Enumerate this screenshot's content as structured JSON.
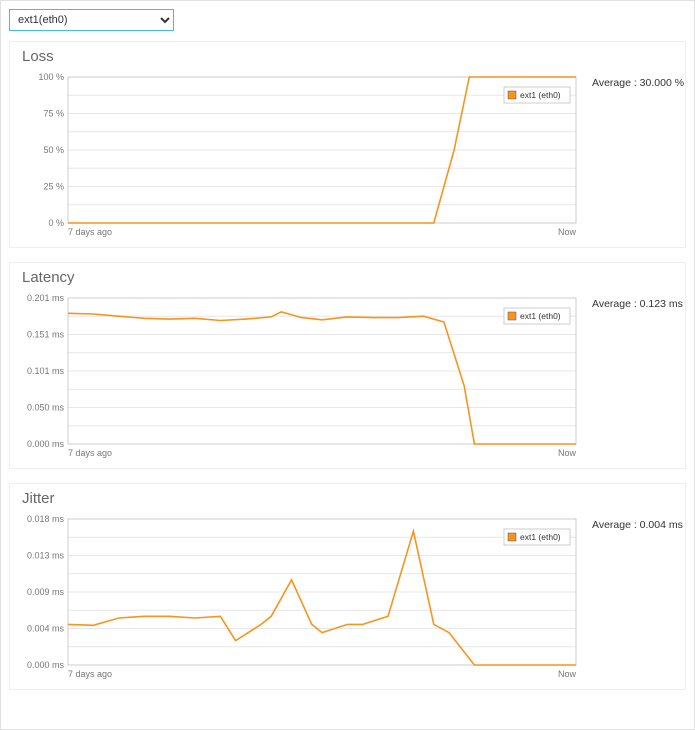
{
  "dropdown": {
    "selected": "ext1(eth0)"
  },
  "legend_label": "ext1 (eth0)",
  "time_axis": {
    "left": "7 days ago",
    "right": "Now"
  },
  "avg_label_prefix": "Average :  ",
  "charts": [
    {
      "key": "loss",
      "title": "Loss",
      "avg": "30.000 %",
      "y_ticks": [
        "0 %",
        "25 %",
        "50 %",
        "75 %",
        "100 %"
      ],
      "ymax": 100
    },
    {
      "key": "latency",
      "title": "Latency",
      "avg": "0.123 ms",
      "y_ticks": [
        "0.000 ms",
        "0.050 ms",
        "0.101 ms",
        "0.151 ms",
        "0.201 ms"
      ],
      "ymax": 0.201
    },
    {
      "key": "jitter",
      "title": "Jitter",
      "avg": "0.004 ms",
      "y_ticks": [
        "0.000 ms",
        "0.004 ms",
        "0.009 ms",
        "0.013 ms",
        "0.018 ms"
      ],
      "ymax": 0.018
    }
  ],
  "chart_data": [
    {
      "type": "line",
      "title": "Loss",
      "xlabel": "",
      "ylabel": "",
      "ylim": [
        0,
        100
      ],
      "x_range": "7 days ago to Now",
      "series": [
        {
          "name": "ext1 (eth0)",
          "x": [
            0.0,
            0.6,
            0.72,
            0.76,
            0.79,
            0.81,
            1.0
          ],
          "values": [
            0,
            0,
            0,
            50,
            100,
            100,
            100
          ]
        }
      ],
      "average": 30.0,
      "unit": "%"
    },
    {
      "type": "line",
      "title": "Latency",
      "xlabel": "",
      "ylabel": "",
      "ylim": [
        0,
        0.201
      ],
      "x_range": "7 days ago to Now",
      "series": [
        {
          "name": "ext1 (eth0)",
          "x": [
            0.0,
            0.05,
            0.1,
            0.15,
            0.2,
            0.25,
            0.3,
            0.35,
            0.4,
            0.42,
            0.46,
            0.5,
            0.55,
            0.6,
            0.65,
            0.7,
            0.74,
            0.78,
            0.8,
            1.0
          ],
          "values": [
            0.18,
            0.179,
            0.176,
            0.173,
            0.172,
            0.173,
            0.17,
            0.172,
            0.175,
            0.182,
            0.174,
            0.171,
            0.175,
            0.174,
            0.174,
            0.176,
            0.168,
            0.08,
            0.0,
            0.0
          ]
        }
      ],
      "average": 0.123,
      "unit": "ms"
    },
    {
      "type": "line",
      "title": "Jitter",
      "xlabel": "",
      "ylabel": "",
      "ylim": [
        0,
        0.018
      ],
      "x_range": "7 days ago to Now",
      "series": [
        {
          "name": "ext1 (eth0)",
          "x": [
            0.0,
            0.05,
            0.1,
            0.15,
            0.2,
            0.25,
            0.3,
            0.33,
            0.38,
            0.4,
            0.44,
            0.48,
            0.5,
            0.55,
            0.58,
            0.63,
            0.68,
            0.72,
            0.75,
            0.8,
            1.0
          ],
          "values": [
            0.005,
            0.0049,
            0.0058,
            0.006,
            0.006,
            0.0058,
            0.006,
            0.003,
            0.005,
            0.006,
            0.0105,
            0.005,
            0.004,
            0.005,
            0.005,
            0.006,
            0.0165,
            0.005,
            0.004,
            0.0,
            0.0
          ]
        }
      ],
      "average": 0.004,
      "unit": "ms"
    }
  ]
}
